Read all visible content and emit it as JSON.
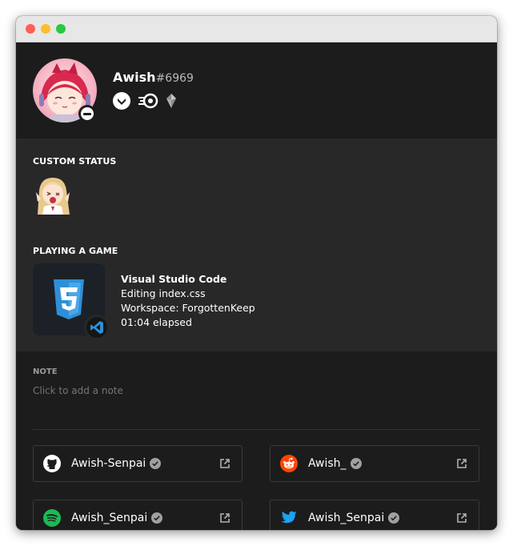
{
  "user": {
    "name": "Awish",
    "discriminator": "#6969",
    "status": "do-not-disturb",
    "badges": [
      "hypesquad-chevron-badge",
      "nitro-boost-badge",
      "gem-badge"
    ]
  },
  "custom_status": {
    "label": "CUSTOM STATUS",
    "emoji": "anime-girl-emoji"
  },
  "game": {
    "label": "PLAYING A GAME",
    "name": "Visual Studio Code",
    "details": "Editing index.css",
    "state": "Workspace: ForgottenKeep",
    "elapsed": "01:04 elapsed",
    "large_icon": "css3-icon",
    "small_icon": "vscode-icon"
  },
  "note": {
    "label": "NOTE",
    "placeholder": "Click to add a note"
  },
  "connections": [
    {
      "service": "github",
      "name": "Awish-Senpai",
      "color": "#ffffff"
    },
    {
      "service": "reddit",
      "name": "Awish_",
      "color": "#ff4500"
    },
    {
      "service": "spotify",
      "name": "Awish_Senpai",
      "color": "#1db954"
    },
    {
      "service": "twitter",
      "name": "Awish_Senpai",
      "color": "#1da1f2"
    }
  ]
}
